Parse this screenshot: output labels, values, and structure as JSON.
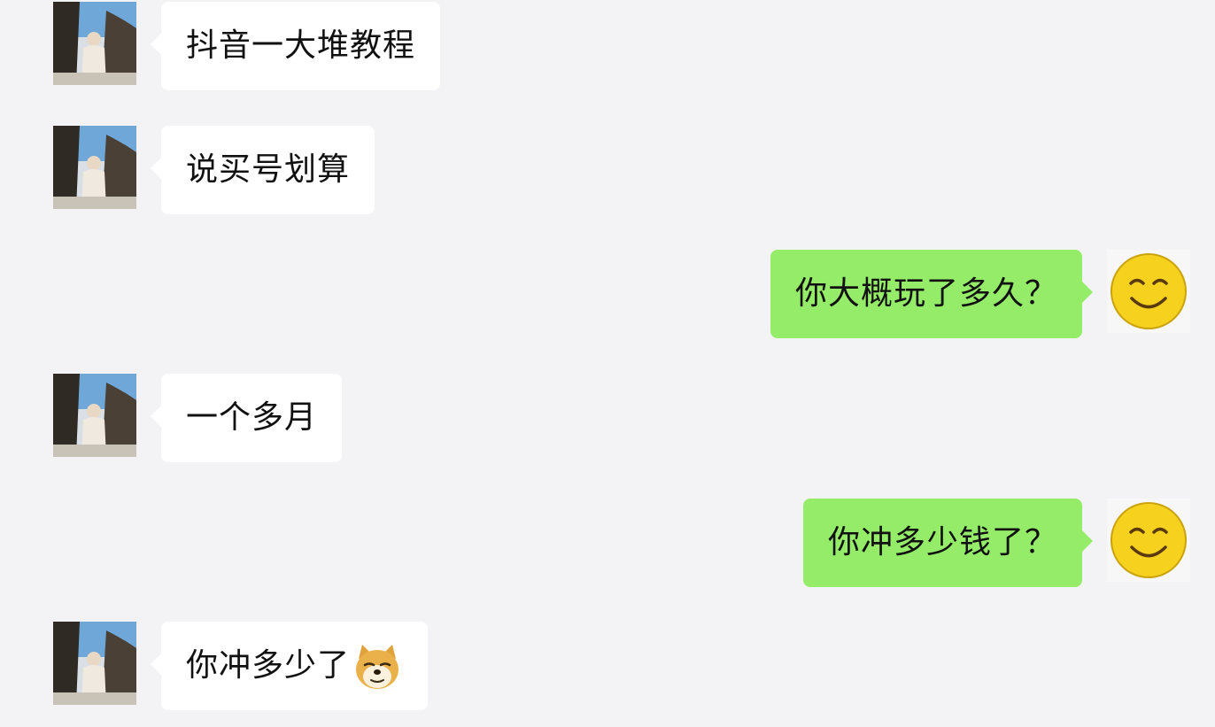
{
  "messages": [
    {
      "side": "in",
      "text": "抖音一大堆教程"
    },
    {
      "side": "in",
      "text": "说买号划算"
    },
    {
      "side": "out",
      "text": "你大概玩了多久？"
    },
    {
      "side": "in",
      "text": "一个多月"
    },
    {
      "side": "out",
      "text": "你冲多少钱了？"
    },
    {
      "side": "in",
      "text": "你冲多少了",
      "emoji": "doge-emoji"
    }
  ],
  "colors": {
    "background": "#f3f3f5",
    "incoming_bubble": "#ffffff",
    "outgoing_bubble": "#95ec69"
  },
  "avatars": {
    "incoming": "photo-avatar",
    "outgoing": "smiley-face-avatar"
  }
}
